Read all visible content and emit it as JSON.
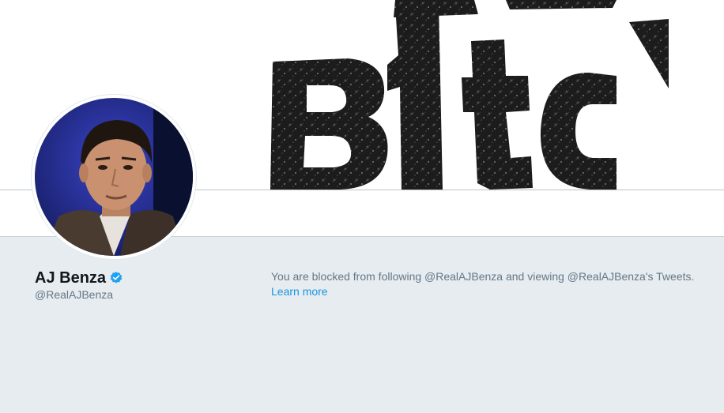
{
  "profile": {
    "name": "AJ Benza",
    "handle": "@RealAJBenza",
    "verified": true
  },
  "banner": {
    "text": "Bitch"
  },
  "blocked_notice": {
    "message": "You are blocked from following @RealAJBenza and viewing @RealAJBenza's Tweets.",
    "link_label": "Learn more"
  },
  "colors": {
    "background": "#e6ecf0",
    "link": "#1b95e0",
    "verified": "#1da1f2",
    "text_primary": "#14171a",
    "text_secondary": "#657786"
  }
}
